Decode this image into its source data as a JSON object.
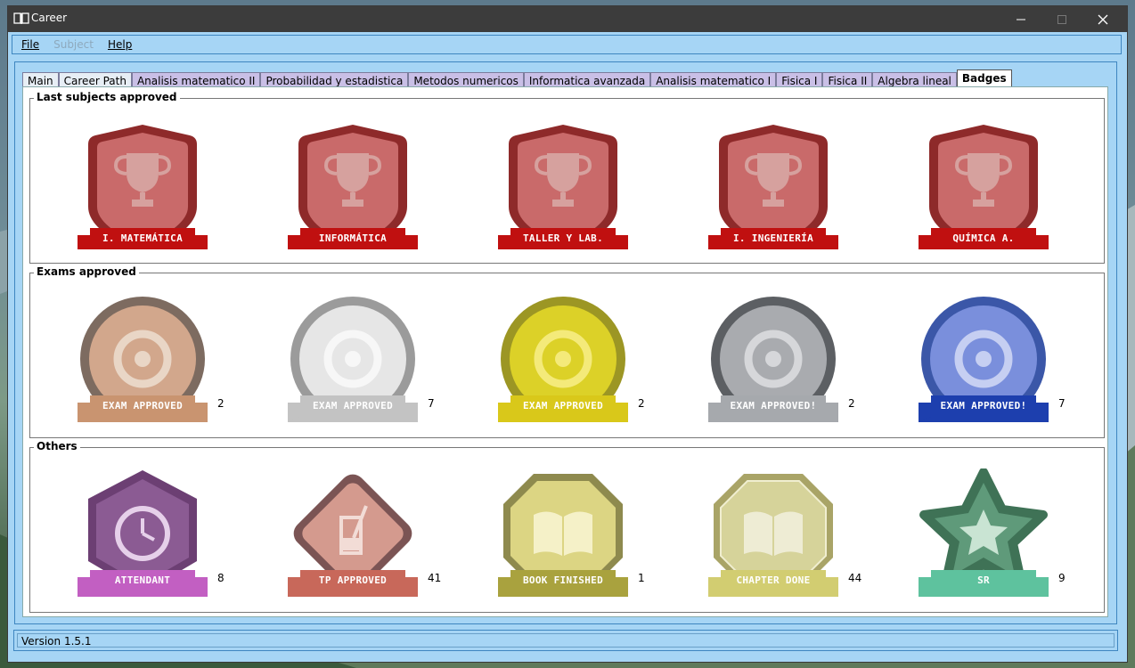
{
  "window": {
    "title": "Career"
  },
  "menu": [
    {
      "label": "File",
      "enabled": true
    },
    {
      "label": "Subject",
      "enabled": false
    },
    {
      "label": "Help",
      "enabled": true
    }
  ],
  "tabs": [
    {
      "label": "Main",
      "style": "light"
    },
    {
      "label": "Career Path",
      "style": "light"
    },
    {
      "label": "Analisis matematico II",
      "style": "purple"
    },
    {
      "label": "Probabilidad y estadistica",
      "style": "purple"
    },
    {
      "label": "Metodos numericos",
      "style": "purple"
    },
    {
      "label": "Informatica avanzada",
      "style": "purple"
    },
    {
      "label": "Analisis matematico I",
      "style": "purple"
    },
    {
      "label": "Fisica I",
      "style": "purple"
    },
    {
      "label": "Fisica II",
      "style": "purple"
    },
    {
      "label": "Algebra lineal",
      "style": "purple"
    },
    {
      "label": "Badges",
      "style": "active"
    }
  ],
  "groups": {
    "subjects": {
      "title": "Last subjects approved",
      "badges": [
        {
          "label": "I. MATEMÁTICA",
          "icon": "trophy-icon"
        },
        {
          "label": "INFORMÁTICA",
          "icon": "trophy-icon"
        },
        {
          "label": "TALLER Y LAB.",
          "icon": "trophy-icon"
        },
        {
          "label": "I. INGENIERÍA",
          "icon": "trophy-icon"
        },
        {
          "label": "QUÍMICA A.",
          "icon": "trophy-icon"
        }
      ]
    },
    "exams": {
      "title": "Exams approved",
      "badges": [
        {
          "label": "EXAM APPROVED",
          "count": "2",
          "outer": "#7d6b60",
          "inner": "#d2a78c",
          "ribbon": "#c99470",
          "ring": "#e9d6c6"
        },
        {
          "label": "EXAM APPROVED",
          "count": "7",
          "outer": "#9b9b9b",
          "inner": "#e6e6e6",
          "ribbon": "#c3c3c3",
          "ring": "#f7f7f7"
        },
        {
          "label": "EXAM APPROVED",
          "count": "2",
          "outer": "#9c9624",
          "inner": "#dcd128",
          "ribbon": "#d9c81a",
          "ring": "#f4ea7a"
        },
        {
          "label": "EXAM APPROVED!",
          "count": "2",
          "outer": "#5c5f63",
          "inner": "#a9abaf",
          "ribbon": "#a6a9ad",
          "ring": "#d6d7da"
        },
        {
          "label": "EXAM APPROVED!",
          "count": "7",
          "outer": "#3b57a8",
          "inner": "#7a8fdc",
          "ribbon": "#1d3fae",
          "ring": "#c6cff2"
        }
      ]
    },
    "others": {
      "title": "Others",
      "badges": [
        {
          "label": "ATTENDANT",
          "count": "8",
          "icon": "clock-icon"
        },
        {
          "label": "TP APPROVED",
          "count": "41",
          "icon": "flask-icon"
        },
        {
          "label": "BOOK FINISHED",
          "count": "1",
          "icon": "book-icon"
        },
        {
          "label": "CHAPTER DONE",
          "count": "44",
          "icon": "book-icon"
        },
        {
          "label": "SR",
          "count": "9",
          "icon": "star-icon"
        }
      ]
    }
  },
  "status": {
    "version": "Version 1.5.1"
  }
}
